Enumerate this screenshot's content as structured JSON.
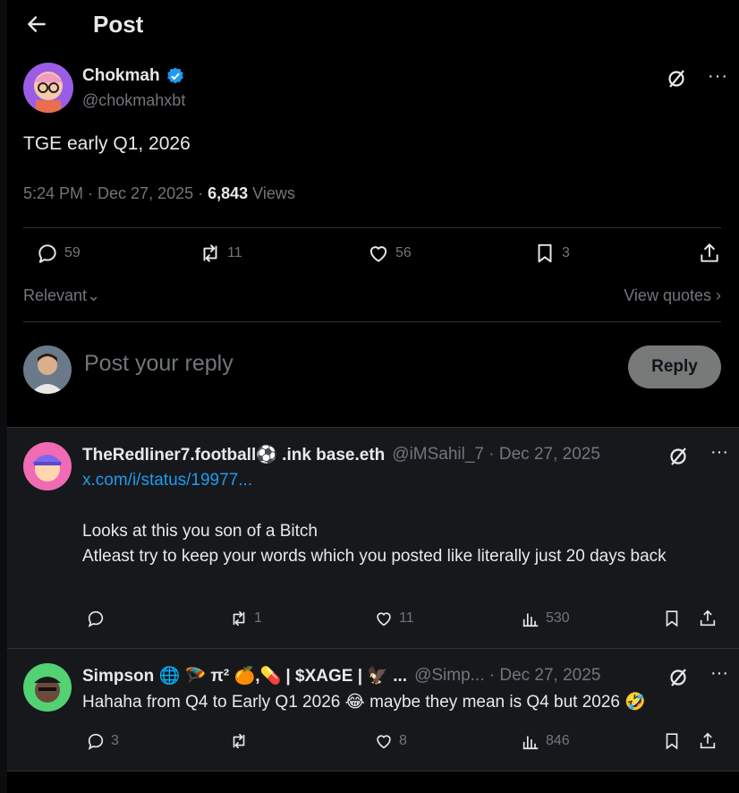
{
  "header": {
    "title": "Post"
  },
  "post": {
    "author_name": "Chokmah",
    "author_handle": "@chokmahxbt",
    "text": "TGE early Q1, 2026",
    "time": "5:24 PM · Dec 27, 2025 · ",
    "views_count": "6,843",
    "views_label": " Views",
    "replies": "59",
    "reposts": "11",
    "likes": "56",
    "bookmarks": "3"
  },
  "sort": {
    "label": "Relevant",
    "view_quotes": "View quotes"
  },
  "compose": {
    "placeholder": "Post your reply",
    "button": "Reply"
  },
  "replies": [
    {
      "name": "TheRedliner7.football⚽ .ink base.eth",
      "handle": "@iMSahil_7 · Dec 27, 2025",
      "link": "x.com/i/status/19977...",
      "text_line1": "Looks at this you son of a Bitch",
      "text_line2": "Atleast try to keep your words which you posted like literally just 20 days back",
      "replies": "",
      "reposts": "1",
      "likes": "11",
      "views": "530"
    },
    {
      "name": "Simpson 🌐 🪂 π² 🍊,💊 | $XAGE | 🦅 ...",
      "handle": "@Simp... · Dec 27, 2025",
      "text": "Hahaha from Q4 to Early Q1 2026 😂 maybe they mean is Q4 but 2026 🤣",
      "replies": "3",
      "reposts": "",
      "likes": "8",
      "views": "846"
    }
  ],
  "icons": {
    "back": "arrow-left-icon",
    "verified": "verified-badge-icon",
    "grok": "grok-icon",
    "more": "more-icon",
    "reply": "reply-icon",
    "repost": "repost-icon",
    "like": "like-icon",
    "bookmark": "bookmark-icon",
    "share": "share-icon",
    "views": "views-icon"
  },
  "colors": {
    "accent": "#1d9bf0",
    "muted": "#71767b",
    "text": "#e7e9ea",
    "reply_bg": "#16181c"
  }
}
